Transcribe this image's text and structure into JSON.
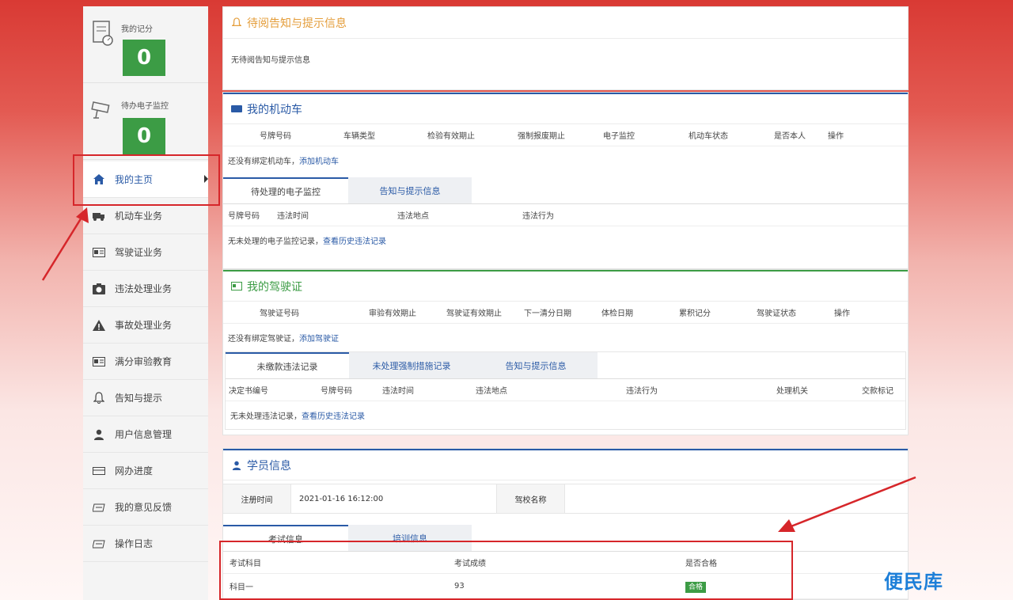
{
  "sidebar": {
    "stats": [
      {
        "label": "我的记分",
        "value": "0",
        "icon": "score-document-icon"
      },
      {
        "label": "待办电子监控",
        "value": "0",
        "icon": "camera-icon"
      }
    ],
    "items": [
      {
        "label": "我的主页",
        "icon": "home-icon"
      },
      {
        "label": "机动车业务",
        "icon": "truck-icon"
      },
      {
        "label": "驾驶证业务",
        "icon": "license-card-icon"
      },
      {
        "label": "违法处理业务",
        "icon": "camera-icon"
      },
      {
        "label": "事故处理业务",
        "icon": "warning-icon"
      },
      {
        "label": "满分审验教育",
        "icon": "card-icon"
      },
      {
        "label": "告知与提示",
        "icon": "bell-icon"
      },
      {
        "label": "用户信息管理",
        "icon": "user-icon"
      },
      {
        "label": "网办进度",
        "icon": "progress-icon"
      },
      {
        "label": "我的意见反馈",
        "icon": "feedback-icon"
      },
      {
        "label": "操作日志",
        "icon": "log-icon"
      }
    ]
  },
  "notice": {
    "title": "待阅告知与提示信息",
    "empty_text": "无待阅告知与提示信息"
  },
  "vehicle": {
    "title": "我的机动车",
    "columns": [
      "号牌号码",
      "车辆类型",
      "检验有效期止",
      "强制报废期止",
      "电子监控",
      "机动车状态",
      "是否本人",
      "操作"
    ],
    "empty_text": "还没有绑定机动车，",
    "add_link": "添加机动车",
    "tabs": [
      "待处理的电子监控",
      "告知与提示信息"
    ],
    "monitor_columns": [
      "号牌号码",
      "违法时间",
      "违法地点",
      "违法行为"
    ],
    "monitor_empty": "无未处理的电子监控记录，",
    "monitor_history_link": "查看历史违法记录"
  },
  "license": {
    "title": "我的驾驶证",
    "columns": [
      "驾驶证号码",
      "审验有效期止",
      "驾驶证有效期止",
      "下一清分日期",
      "体检日期",
      "累积记分",
      "驾驶证状态",
      "操作"
    ],
    "empty_text": "还没有绑定驾驶证，",
    "add_link": "添加驾驶证",
    "tabs": [
      "未缴款违法记录",
      "未处理强制措施记录",
      "告知与提示信息"
    ],
    "violation_columns": [
      "决定书编号",
      "号牌号码",
      "违法时间",
      "违法地点",
      "违法行为",
      "处理机关",
      "交款标记"
    ],
    "violation_empty": "无未处理违法记录，",
    "violation_history_link": "查看历史违法记录"
  },
  "student": {
    "title": "学员信息",
    "reg_label": "注册时间",
    "reg_value": "2021-01-16 16:12:00",
    "school_label": "驾校名称",
    "school_value": "",
    "tabs": [
      "考试信息",
      "培训信息"
    ],
    "exam_columns": [
      "考试科目",
      "考试成绩",
      "是否合格"
    ],
    "exam_rows": [
      {
        "subject": "科目一",
        "score": "93",
        "pass": "合格"
      }
    ]
  },
  "watermark": "便民库",
  "colors": {
    "accent": "#2a5aa6",
    "green": "#3c9c45",
    "orange": "#e49d3a",
    "highlight": "#d6262a"
  }
}
